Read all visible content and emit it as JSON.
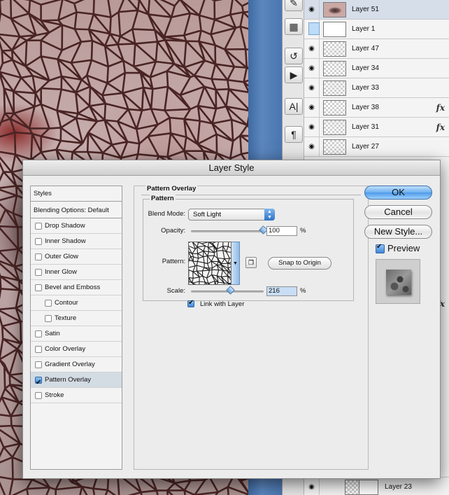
{
  "dialog": {
    "title": "Layer Style",
    "buttons": {
      "ok": "OK",
      "cancel": "Cancel",
      "new_style": "New Style...",
      "preview": "Preview"
    }
  },
  "styles_list": {
    "header": "Styles",
    "blending_options": "Blending Options: Default",
    "items": [
      {
        "label": "Drop Shadow",
        "checked": false,
        "indent": false
      },
      {
        "label": "Inner Shadow",
        "checked": false,
        "indent": false
      },
      {
        "label": "Outer Glow",
        "checked": false,
        "indent": false
      },
      {
        "label": "Inner Glow",
        "checked": false,
        "indent": false
      },
      {
        "label": "Bevel and Emboss",
        "checked": false,
        "indent": false
      },
      {
        "label": "Contour",
        "checked": false,
        "indent": true
      },
      {
        "label": "Texture",
        "checked": false,
        "indent": true
      },
      {
        "label": "Satin",
        "checked": false,
        "indent": false
      },
      {
        "label": "Color Overlay",
        "checked": false,
        "indent": false
      },
      {
        "label": "Gradient Overlay",
        "checked": false,
        "indent": false
      },
      {
        "label": "Pattern Overlay",
        "checked": true,
        "indent": false,
        "active": true
      },
      {
        "label": "Stroke",
        "checked": false,
        "indent": false
      }
    ]
  },
  "pattern_overlay": {
    "section_title": "Pattern Overlay",
    "group_title": "Pattern",
    "blend_mode_label": "Blend Mode:",
    "blend_mode_value": "Soft Light",
    "opacity_label": "Opacity:",
    "opacity_value": "100",
    "opacity_unit": "%",
    "opacity_fraction": 1.0,
    "pattern_label": "Pattern:",
    "snap_button": "Snap to Origin",
    "scale_label": "Scale:",
    "scale_value": "216",
    "scale_unit": "%",
    "scale_fraction": 0.55,
    "link_with_layer": "Link with Layer",
    "link_checked": true
  },
  "layers_panel": {
    "layers": [
      {
        "name": "Layer 51",
        "thumb": "face",
        "selected": true,
        "fx": ""
      },
      {
        "name": "Layer 1",
        "thumb": "blank",
        "selected": false,
        "fx": ""
      },
      {
        "name": "Layer 47",
        "thumb": "checker",
        "selected": false,
        "fx": ""
      },
      {
        "name": "Layer 34",
        "thumb": "checker",
        "selected": false,
        "fx": ""
      },
      {
        "name": "Layer 33",
        "thumb": "checker",
        "selected": false,
        "fx": ""
      },
      {
        "name": "Layer 38",
        "thumb": "checker",
        "selected": false,
        "fx": "fx"
      },
      {
        "name": "Layer 31",
        "thumb": "checker",
        "selected": false,
        "fx": "fx"
      },
      {
        "name": "Layer 27",
        "thumb": "checker",
        "selected": false,
        "fx": ""
      }
    ],
    "bottom_layer": {
      "name": "Layer 23"
    },
    "extra_fx": "fx"
  },
  "colors": {
    "accent_blue": "#4f9ae8",
    "selected_row": "#d5dee9",
    "desktop_blue": "#4a76b0"
  }
}
